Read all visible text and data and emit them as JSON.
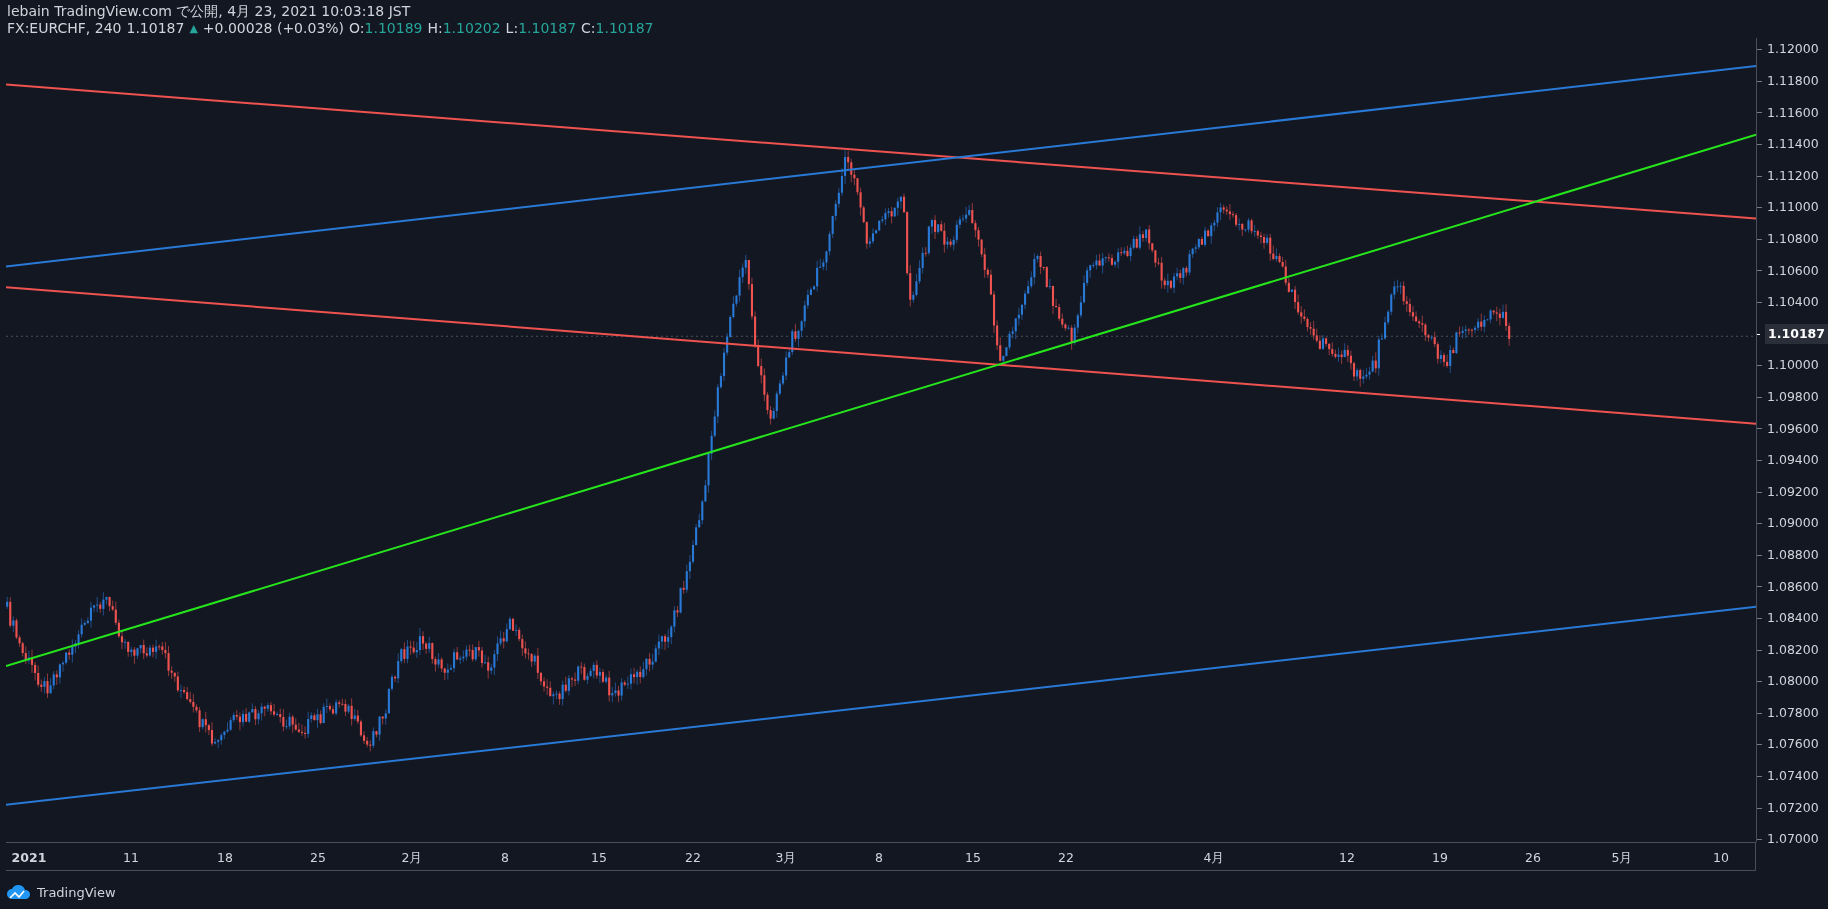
{
  "header": {
    "title": "lebain TradingView.com で公開, 4月 23, 2021 10:03:18 JST",
    "quote": {
      "symbol": "FX:EURCHF, 240",
      "last": "1.10187",
      "arrow": "▲",
      "change": "+0.00028 (+0.03%)",
      "ohlc": [
        {
          "label": "O:",
          "value": "1.10189"
        },
        {
          "label": "H:",
          "value": "1.10202"
        },
        {
          "label": "L:",
          "value": "1.10187"
        },
        {
          "label": "C:",
          "value": "1.10187"
        }
      ]
    }
  },
  "price_axis": [
    {
      "kind": "tick",
      "text": "1.12000"
    },
    {
      "kind": "tick",
      "text": "1.11800"
    },
    {
      "kind": "tick",
      "text": "1.11600"
    },
    {
      "kind": "tick",
      "text": "1.11400"
    },
    {
      "kind": "tick",
      "text": "1.11200"
    },
    {
      "kind": "tick",
      "text": "1.11000"
    },
    {
      "kind": "tick",
      "text": "1.10800"
    },
    {
      "kind": "tick",
      "text": "1.10600"
    },
    {
      "kind": "tick",
      "text": "1.10400"
    },
    {
      "kind": "current",
      "text": "1.10187"
    },
    {
      "kind": "tick",
      "text": "1.10000"
    },
    {
      "kind": "tick",
      "text": "1.09800"
    },
    {
      "kind": "tick",
      "text": "1.09600"
    },
    {
      "kind": "tick",
      "text": "1.09400"
    },
    {
      "kind": "tick",
      "text": "1.09200"
    },
    {
      "kind": "tick",
      "text": "1.09000"
    },
    {
      "kind": "tick",
      "text": "1.08800"
    },
    {
      "kind": "tick",
      "text": "1.08600"
    },
    {
      "kind": "tick",
      "text": "1.08400"
    },
    {
      "kind": "tick",
      "text": "1.08200"
    },
    {
      "kind": "tick",
      "text": "1.08000"
    },
    {
      "kind": "tick",
      "text": "1.07800"
    },
    {
      "kind": "tick",
      "text": "1.07600"
    },
    {
      "kind": "tick",
      "text": "1.07400"
    },
    {
      "kind": "tick",
      "text": "1.07200"
    },
    {
      "kind": "tick",
      "text": "1.07000"
    }
  ],
  "time_axis": [
    {
      "text": "2021",
      "kind": "year"
    },
    {
      "text": "11",
      "kind": "day"
    },
    {
      "text": "18",
      "kind": "day"
    },
    {
      "text": "25",
      "kind": "day"
    },
    {
      "text": "2月",
      "kind": "month"
    },
    {
      "text": "8",
      "kind": "day"
    },
    {
      "text": "15",
      "kind": "day"
    },
    {
      "text": "22",
      "kind": "day"
    },
    {
      "text": "3月",
      "kind": "month"
    },
    {
      "text": "8",
      "kind": "day"
    },
    {
      "text": "15",
      "kind": "day"
    },
    {
      "text": "22",
      "kind": "day"
    },
    {
      "text": "4月",
      "kind": "month"
    },
    {
      "text": "12",
      "kind": "day"
    },
    {
      "text": "19",
      "kind": "day"
    },
    {
      "text": "26",
      "kind": "day"
    },
    {
      "text": "5月",
      "kind": "month"
    },
    {
      "text": "10",
      "kind": "day"
    }
  ],
  "footer": {
    "brand": "TradingView"
  }
}
